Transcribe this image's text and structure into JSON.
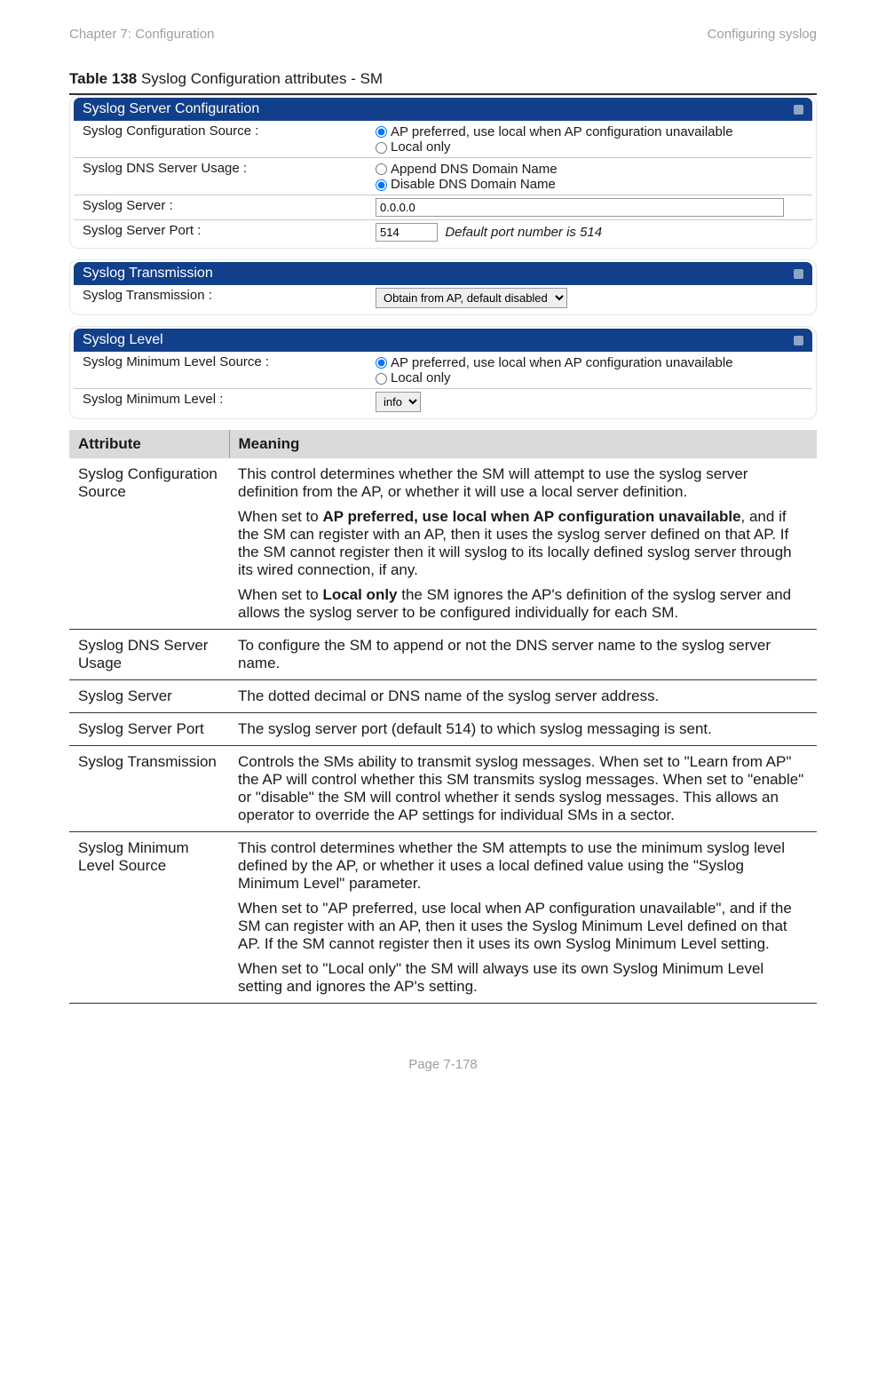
{
  "header": {
    "left": "Chapter 7:  Configuration",
    "right": "Configuring syslog"
  },
  "caption": {
    "prefix": "Table 138",
    "rest": " Syslog Configuration attributes - SM"
  },
  "panel1": {
    "title": "Syslog Server Configuration",
    "r1": {
      "label": "Syslog Configuration Source :",
      "opt1": "AP preferred, use local when AP configuration unavailable",
      "opt2": "Local only"
    },
    "r2": {
      "label": "Syslog DNS Server Usage :",
      "opt1": "Append DNS Domain Name",
      "opt2": "Disable DNS Domain Name"
    },
    "r3": {
      "label": "Syslog Server :",
      "val": "0.0.0.0"
    },
    "r4": {
      "label": "Syslog Server Port :",
      "val": "514",
      "hint": "Default port number is 514"
    }
  },
  "panel2": {
    "title": "Syslog Transmission",
    "r1": {
      "label": "Syslog Transmission :",
      "sel": "Obtain from AP, default disabled"
    }
  },
  "panel3": {
    "title": "Syslog Level",
    "r1": {
      "label": "Syslog Minimum Level Source :",
      "opt1": "AP preferred, use local when AP configuration unavailable",
      "opt2": "Local only"
    },
    "r2": {
      "label": "Syslog Minimum Level :",
      "sel": "info"
    }
  },
  "table": {
    "h1": "Attribute",
    "h2": "Meaning",
    "rows": [
      {
        "a": "Syslog Configuration Source",
        "m": [
          {
            "t": "This control determines whether the SM will attempt to use the syslog server definition from the AP, or whether it will use a local server definition."
          },
          {
            "pre": "When set to ",
            "b": "AP preferred, use local when AP configuration unavailable",
            "post": ", and if the SM can register with an AP, then it uses the syslog server defined on that AP. If the SM cannot register then it will syslog to its locally defined syslog server through its wired connection, if any."
          },
          {
            "pre": "When set to ",
            "b": "Local only",
            "post": " the SM ignores the AP's definition of the syslog server and allows the syslog server to be configured individually for each SM."
          }
        ]
      },
      {
        "a": "Syslog DNS Server Usage",
        "m": [
          {
            "t": "To configure the SM to append or not the DNS server name to the syslog server name."
          }
        ]
      },
      {
        "a": "Syslog Server",
        "m": [
          {
            "t": "The dotted decimal or DNS name of the syslog server address."
          }
        ]
      },
      {
        "a": "Syslog Server Port",
        "m": [
          {
            "t": "The syslog server port (default 514) to which syslog messaging is sent."
          }
        ]
      },
      {
        "a": "Syslog Transmission",
        "m": [
          {
            "t": "Controls the SMs ability to transmit syslog messages. When set to \"Learn from AP\" the AP will control whether this SM transmits syslog messages. When set to \"enable\" or \"disable\" the SM will control whether it sends syslog messages. This allows an operator to override the AP settings for individual SMs in a sector."
          }
        ]
      },
      {
        "a": "Syslog Minimum Level Source",
        "m": [
          {
            "t": "This control determines whether the SM attempts to use the minimum syslog level defined by the AP, or whether it uses a local defined value using the \"Syslog Minimum Level\" parameter."
          },
          {
            "t": "When set to \"AP preferred, use local when AP configuration unavailable\", and if the SM can register with an AP, then it uses the Syslog Minimum Level defined on that AP. If the SM cannot register then it uses its own Syslog Minimum Level setting."
          },
          {
            "t": "When set to \"Local only\" the SM will always use its own Syslog Minimum Level setting and ignores the AP's setting."
          }
        ]
      }
    ]
  },
  "footer": "Page 7-178"
}
